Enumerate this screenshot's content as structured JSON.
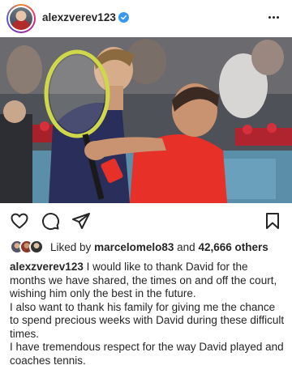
{
  "post": {
    "username": "alexzverev123",
    "verified": true,
    "likes": {
      "prefix": "Liked by",
      "liker": "marcelomelo83",
      "connector": "and",
      "count_text": "42,666 others"
    },
    "caption": {
      "username": "alexzverev123",
      "text": "I would like to thank David for the months we have shared, the times on and off the court, wishing him only the best in the future.",
      "paragraph_2": "I also want to thank his family for giving me the chance to spend precious weeks with David during these difficult times.",
      "paragraph_3": "I have tremendous respect for the way David played and coaches tennis."
    }
  },
  "icons": {
    "more": "more-options-icon",
    "like": "heart-icon",
    "comment": "comment-icon",
    "share": "send-icon",
    "save": "bookmark-icon",
    "tag": "user-tag-icon"
  },
  "colors": {
    "verified": "#3897f0",
    "text": "#262626"
  }
}
